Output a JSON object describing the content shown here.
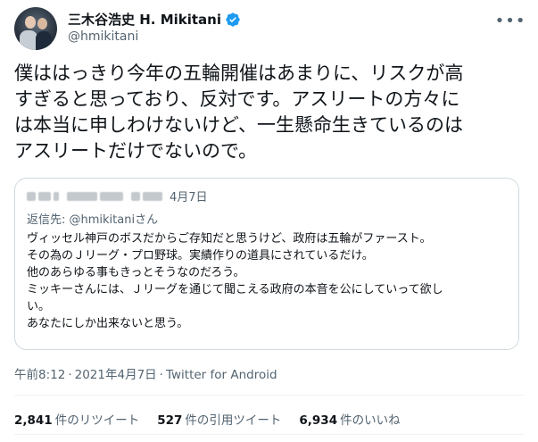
{
  "author": {
    "display_name": "三木谷浩史 H. Mikitani",
    "handle": "@hmikitani",
    "verified": true
  },
  "tweet": {
    "lines": [
      "僕ははっきり今年の五輪開催はあまりに、リスクが高",
      "すぎると思っており、反対です。アスリートの方々に",
      "は本当に申しわけないけど、一生懸命生きているのは",
      "アスリートだけでないので。"
    ]
  },
  "quote": {
    "date": "4月7日",
    "reply_prefix": "返信先: ",
    "reply_mention": "@hmikitaniさん",
    "lines": [
      "ヴィッセル神戸のボスだからご存知だと思うけど、政府は五輪がファースト。",
      "その為のＪリーグ・プロ野球。実績作りの道具にされているだけ。",
      "他のあらゆる事もきっとそうなのだろう。",
      "ミッキーさんには、Ｊリーグを通じて聞こえる政府の本音を公にしていって欲し",
      "い。",
      "あなたにしか出来ないと思う。"
    ]
  },
  "meta": {
    "time": "午前8:12",
    "separator": "·",
    "date": "2021年4月7日",
    "client": "Twitter for Android"
  },
  "stats": [
    {
      "count": "2,841",
      "label": "件のリツイート"
    },
    {
      "count": "527",
      "label": "件の引用ツイート"
    },
    {
      "count": "6,934",
      "label": "件のいいね"
    }
  ],
  "colors": {
    "verified_badge": "#1d9bf0",
    "secondary_text": "#536471",
    "border": "#cfd9de"
  },
  "icons": {
    "verified": "verified-badge-icon",
    "more": "more-options-icon"
  }
}
